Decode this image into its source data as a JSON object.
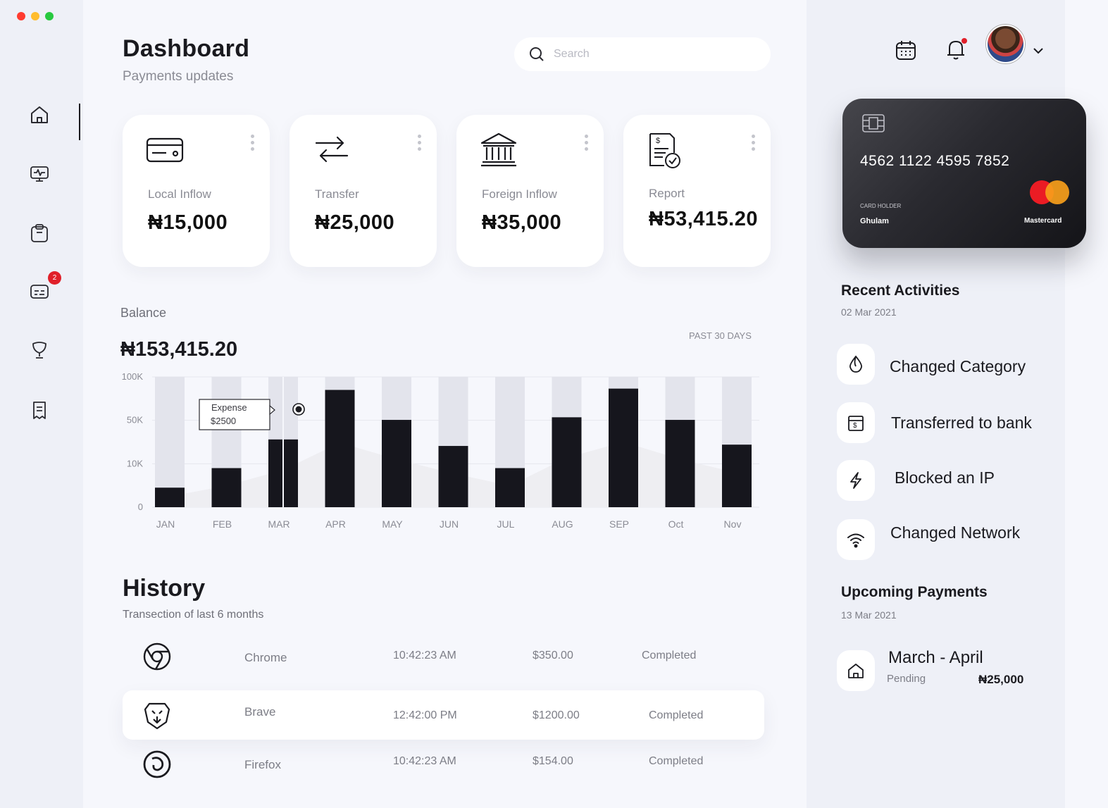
{
  "window": {
    "controls": [
      "close",
      "minimize",
      "maximize"
    ],
    "colors": [
      "#ff3b30",
      "#ffbd2e",
      "#27c93f"
    ]
  },
  "sidebar": {
    "items": [
      {
        "icon": "home-icon",
        "active": true
      },
      {
        "icon": "monitor-icon"
      },
      {
        "icon": "clipboard-icon"
      },
      {
        "icon": "message-icon",
        "badge": "2"
      },
      {
        "icon": "trophy-icon"
      },
      {
        "icon": "receipt-icon"
      }
    ]
  },
  "header": {
    "title": "Dashboard",
    "subtitle": "Payments updates"
  },
  "search": {
    "placeholder": "Search"
  },
  "cards": [
    {
      "label": "Local  Inflow",
      "amount": "₦15,000",
      "icon": "credit-card-icon"
    },
    {
      "label": "Transfer",
      "amount": "₦25,000",
      "icon": "transfer-arrows-icon"
    },
    {
      "label": "Foreign Inflow",
      "amount": "₦35,000",
      "icon": "bank-icon"
    },
    {
      "label": "Report",
      "amount": "₦53,415.20",
      "icon": "report-document-icon"
    }
  ],
  "balance": {
    "label": "Balance",
    "amount": "₦153,415.20",
    "period": "PAST 30 DAYS"
  },
  "chart_data": {
    "type": "bar",
    "categories": [
      "JAN",
      "FEB",
      "MAR",
      "APR",
      "MAY",
      "JUN",
      "JUL",
      "AUG",
      "SEP",
      "Oct",
      "Nov"
    ],
    "y_ticks": [
      "100K",
      "50K",
      "10K",
      "0"
    ],
    "series": [
      {
        "values": [
          15,
          30,
          52,
          90,
          67,
          47,
          30,
          69,
          91,
          67,
          48
        ]
      }
    ],
    "background_bar_max": 100,
    "tooltip": {
      "label": "Expense",
      "value": "$2500",
      "category": "MAR"
    },
    "colors": {
      "bar": "#16161d",
      "track": "#e3e4ec"
    }
  },
  "history": {
    "title": "History",
    "subtitle": "Transection of last 6 months",
    "rows": [
      {
        "name": "Chrome",
        "time": "10:42:23 AM",
        "amount": "$350.00",
        "status": "Completed",
        "icon": "chrome-icon"
      },
      {
        "name": "Brave",
        "time": "12:42:00 PM",
        "amount": "$1200.00",
        "status": "Completed",
        "icon": "brave-lion-icon",
        "highlighted": true
      },
      {
        "name": "Firefox",
        "time": "10:42:23 AM",
        "amount": "$154.00",
        "status": "Completed",
        "icon": "firefox-icon"
      }
    ]
  },
  "card": {
    "number": "4562 1122 4595 7852",
    "holder_label": "CARD HOLDER",
    "holder": "Ghulam",
    "brand": "Mastercard"
  },
  "recent": {
    "title": "Recent Activities",
    "date": "02 Mar 2021",
    "items": [
      {
        "label": "Changed Category",
        "icon": "drop-icon"
      },
      {
        "label": "Transferred to bank",
        "icon": "wallet-dollar-icon"
      },
      {
        "label": "Blocked an IP",
        "icon": "lightning-icon"
      },
      {
        "label": "Changed Network",
        "icon": "wifi-icon"
      }
    ]
  },
  "upcoming": {
    "title": "Upcoming Payments",
    "date": "13 Mar 2021",
    "item": {
      "name": "March - April",
      "status": "Pending",
      "amount": "₦25,000",
      "icon": "home-icon"
    }
  }
}
